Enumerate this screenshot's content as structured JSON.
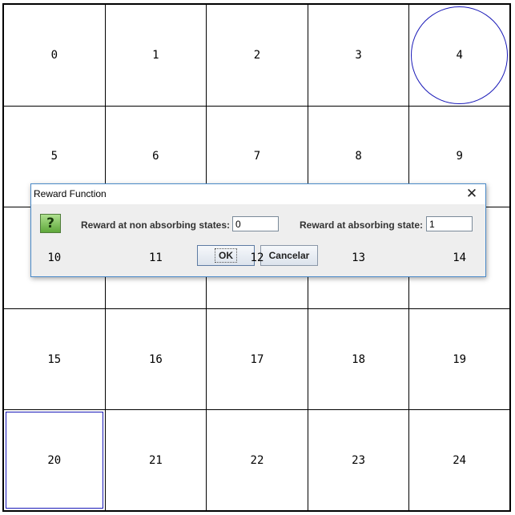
{
  "grid": {
    "cells": [
      "0",
      "1",
      "2",
      "3",
      "4",
      "5",
      "6",
      "7",
      "8",
      "9",
      "10",
      "11",
      "12",
      "13",
      "14",
      "15",
      "16",
      "17",
      "18",
      "19",
      "20",
      "21",
      "22",
      "23",
      "24"
    ],
    "columns": 5,
    "goal_cell": 4,
    "agent_cell": 20
  },
  "dialog": {
    "title": "Reward Function",
    "close_glyph": "✕",
    "question_glyph": "?",
    "non_absorbing_label": "Reward at non absorbing states:",
    "non_absorbing_value": "0",
    "absorbing_label": "Reward at absorbing state:",
    "absorbing_value": "1",
    "ok_label": "OK",
    "cancel_label": "Cancelar"
  },
  "colors": {
    "marker_blue": "#1a1ab8",
    "dialog_border": "#4a8ac8"
  }
}
